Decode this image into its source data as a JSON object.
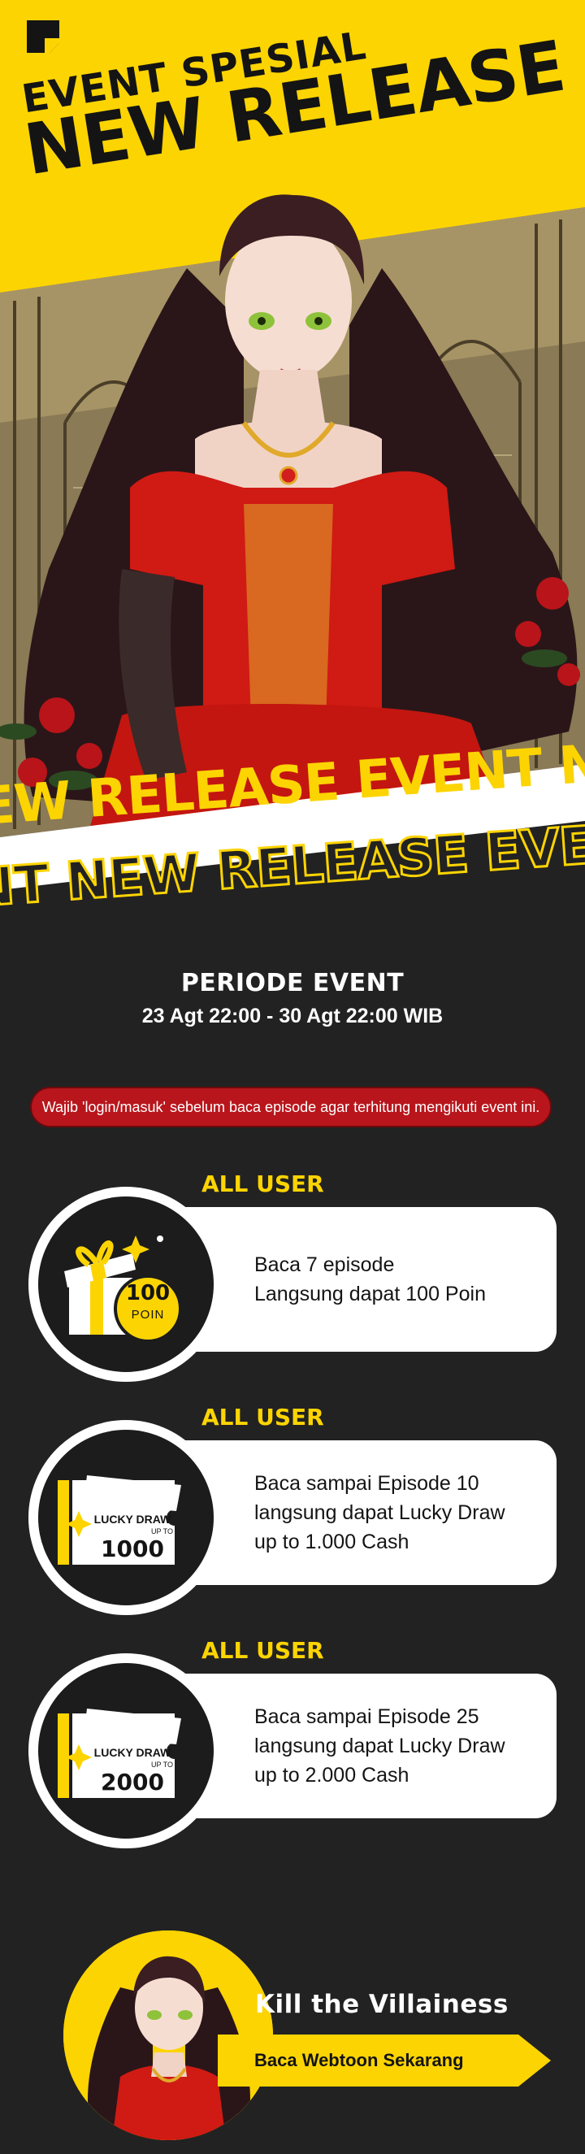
{
  "hero": {
    "kicker": "EVENT SPESIAL",
    "title": "NEW RELEASE",
    "marquee_line_1": "NEW RELEASE EVENT NEW RELEASE EVENT",
    "marquee_line_2": "ENT NEW RELEASE EVENT NEW RELEASE EV",
    "marquee_line_3": "NEW RELEASE EVENT NEW REL"
  },
  "period": {
    "title": "PERIODE EVENT",
    "dates": "23 Agt 22:00 - 30 Agt 22:00 WIB"
  },
  "notice": "Wajib 'login/masuk' sebelum baca episode agar terhitung mengikuti event ini.",
  "events": [
    {
      "tag": "ALL USER",
      "lines": [
        "Baca 7 episode",
        "Langsung dapat 100 Poin"
      ],
      "icon": "gift-box-icon",
      "badge_value": "100",
      "badge_unit": "POIN"
    },
    {
      "tag": "ALL USER",
      "lines": [
        "Baca sampai Episode 10",
        "langsung dapat Lucky Draw",
        "up to 1.000 Cash"
      ],
      "icon": "lucky-draw-ticket-icon",
      "ticket_title": "LUCKY DRAW",
      "ticket_sub": "UP TO",
      "ticket_value": "1000"
    },
    {
      "tag": "ALL USER",
      "lines": [
        "Baca sampai Episode 25",
        "langsung dapat Lucky Draw",
        "up to 2.000 Cash"
      ],
      "icon": "lucky-draw-ticket-icon",
      "ticket_title": "LUCKY DRAW",
      "ticket_sub": "UP TO",
      "ticket_value": "2000"
    }
  ],
  "promo": {
    "title": "Kill the Villainess",
    "cta": "Baca Webtoon Sekarang"
  },
  "colors": {
    "brand_yellow": "#fcd402",
    "background": "#222222",
    "notice_red": "#b8161c",
    "dress_red": "#d01a14",
    "hair": "#2a1618"
  }
}
